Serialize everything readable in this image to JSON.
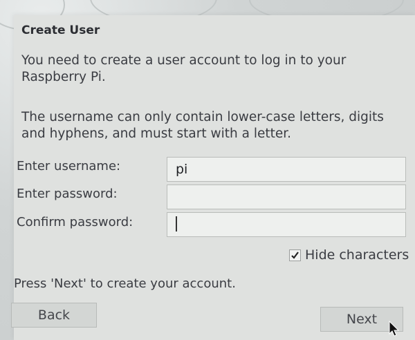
{
  "dialog": {
    "title": "Create User",
    "intro": "You need to create a user account to log in to your Raspberry Pi.",
    "rules": "The username can only contain lower-case letters, digits and hyphens, and must start with a letter.",
    "fields": {
      "username": {
        "label": "Enter username:",
        "value": "pi"
      },
      "password": {
        "label": "Enter password:",
        "value": ""
      },
      "confirm": {
        "label": "Confirm password:",
        "value": ""
      }
    },
    "hide_characters": {
      "label": "Hide characters",
      "checked": true
    },
    "hint": "Press 'Next' to create your account.",
    "buttons": {
      "back": "Back",
      "next": "Next"
    }
  },
  "icons": [
    "checkmark-icon",
    "mouse-pointer-icon"
  ]
}
